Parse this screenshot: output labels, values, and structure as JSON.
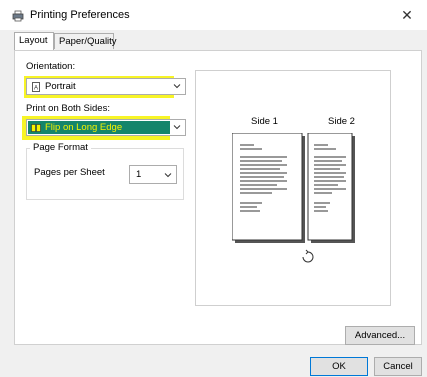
{
  "window": {
    "title": "Printing Preferences",
    "close_glyph": "✕"
  },
  "tabs": [
    {
      "label": "Layout",
      "active": true
    },
    {
      "label": "Paper/Quality",
      "active": false
    }
  ],
  "layout": {
    "orientation_label": "Orientation:",
    "orientation_value": "Portrait",
    "duplex_label": "Print on Both Sides:",
    "duplex_value": "Flip on Long Edge",
    "page_format_title": "Page Format",
    "pages_per_sheet_label": "Pages per Sheet",
    "pages_per_sheet_value": "1"
  },
  "preview": {
    "side1_label": "Side 1",
    "side2_label": "Side 2"
  },
  "buttons": {
    "advanced": "Advanced...",
    "ok": "OK",
    "cancel": "Cancel"
  },
  "colors": {
    "highlight_yellow": "#f6f200",
    "selected_blue": "#0a5fc7",
    "accent_green": "#1fa41f"
  }
}
